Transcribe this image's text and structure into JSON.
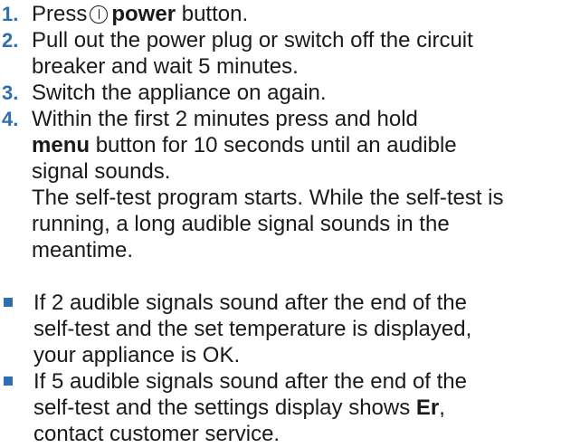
{
  "steps": [
    {
      "num": "1.",
      "pre": "Press",
      "bold": "power",
      "post": "button."
    },
    {
      "num": "2.",
      "line1": "Pull out the power plug or switch off the circuit",
      "line2": "breaker and wait 5 minutes."
    },
    {
      "num": "3.",
      "line1": "Switch the appliance on again."
    },
    {
      "num": "4.",
      "line1": "Within the first 2 minutes press and hold",
      "bold": "menu",
      "line2_post": "button for 10 seconds until an audible",
      "line3": "signal sounds.",
      "line4": "The self-test program starts. While the self-test is",
      "line5": "running, a long audible signal sounds in the",
      "line6": "meantime."
    }
  ],
  "bullets": [
    {
      "line1": "If 2 audible signals sound after the end of the",
      "line2": "self-test and the set temperature is displayed,",
      "line3": "your appliance is OK."
    },
    {
      "line1": "If 5 audible signals sound after the end of the",
      "line2_pre": "self-test and the settings display shows",
      "bold": "Er",
      "line2_post": ",",
      "line3": "contact customer service."
    }
  ],
  "colors": {
    "accent": "#2d6fb0",
    "text": "#1a1a1a"
  },
  "icons": {
    "power": "power-icon"
  }
}
